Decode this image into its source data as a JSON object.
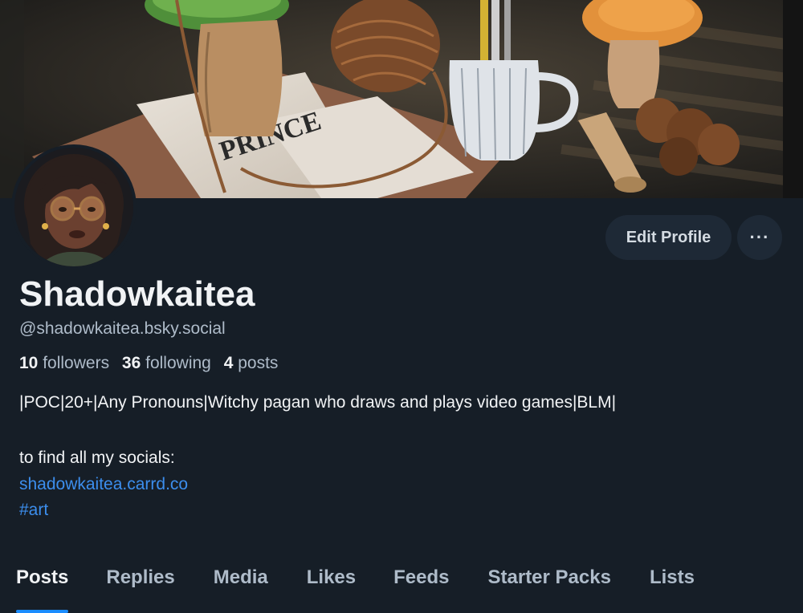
{
  "profile": {
    "display_name": "Shadowkaitea",
    "handle": "@shadowkaitea.bsky.social",
    "stats": {
      "followers_count": "10",
      "followers_label": "followers",
      "following_count": "36",
      "following_label": "following",
      "posts_count": "4",
      "posts_label": "posts"
    },
    "bio": {
      "line1": "|POC|20+|Any Pronouns|Witchy pagan who draws and plays video games|BLM|",
      "line2": "to find all my socials:",
      "link": "shadowkaitea.carrd.co",
      "tag": "#art"
    }
  },
  "actions": {
    "edit_label": "Edit Profile",
    "more_label": "···"
  },
  "tabs": [
    {
      "label": "Posts",
      "active": true
    },
    {
      "label": "Replies",
      "active": false
    },
    {
      "label": "Media",
      "active": false
    },
    {
      "label": "Likes",
      "active": false
    },
    {
      "label": "Feeds",
      "active": false
    },
    {
      "label": "Starter Packs",
      "active": false
    },
    {
      "label": "Lists",
      "active": false
    }
  ],
  "banner": {
    "book_title": "PRINCE"
  },
  "colors": {
    "background": "#161e27",
    "button_bg": "#1e2936",
    "link": "#3c8eed",
    "accent": "#1a8cff",
    "muted_text": "#aebbc9"
  }
}
